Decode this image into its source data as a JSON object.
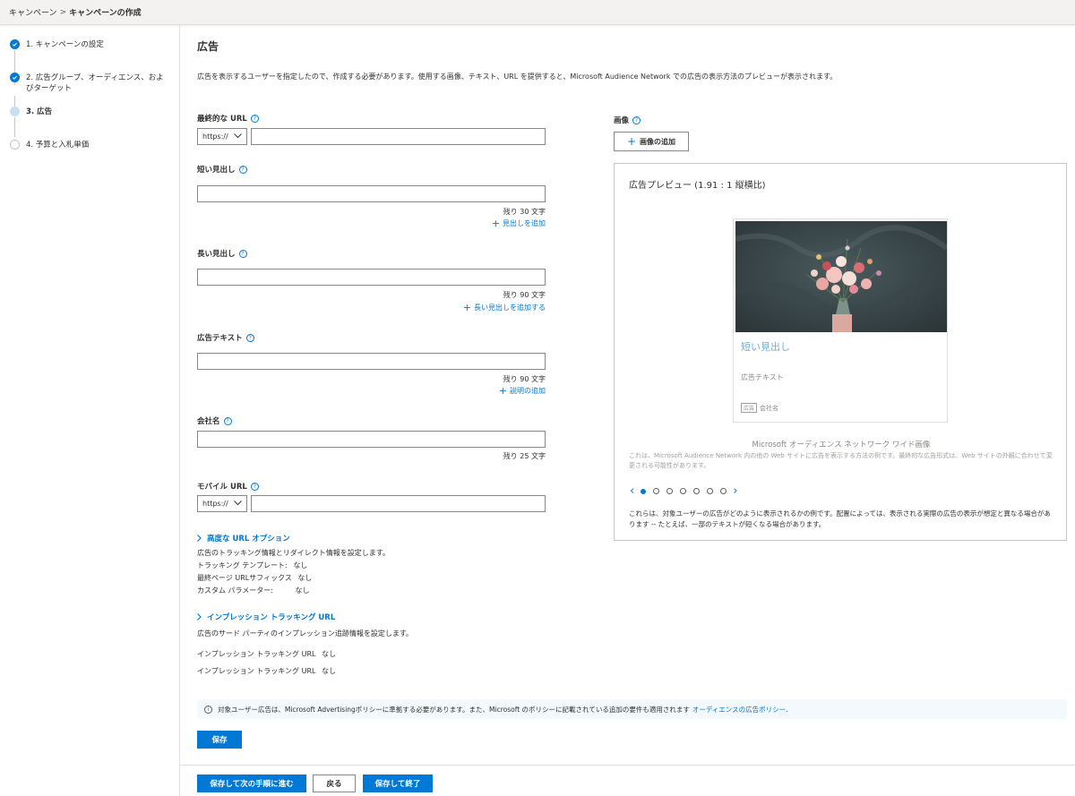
{
  "breadcrumb": {
    "parent": "キャンペーン",
    "separator": ">",
    "current": "キャンペーンの作成"
  },
  "steps": [
    {
      "label": "1. キャンペーンの設定",
      "state": "done"
    },
    {
      "label": "2. 広告グループ、オーディエンス、およびターゲット",
      "state": "done"
    },
    {
      "label": "3. 広告",
      "state": "current"
    },
    {
      "label": "4. 予算と入札単価",
      "state": "todo"
    }
  ],
  "page": {
    "title": "広告",
    "description": "広告を表示するユーザーを指定したので、作成する必要があります。使用する画像、テキスト、URL を提供すると、Microsoft Audience Network での広告の表示方法のプレビューが表示されます。"
  },
  "form": {
    "final_url": {
      "label": "最終的な URL",
      "protocol": "https://",
      "value": ""
    },
    "short_headline": {
      "label": "短い見出し",
      "value": "",
      "remaining": "残り 30 文字",
      "add_link": "見出しを追加"
    },
    "long_headline": {
      "label": "長い見出し",
      "value": "",
      "remaining": "残り 90 文字",
      "add_link": "長い見出しを追加する"
    },
    "ad_text": {
      "label": "広告テキスト",
      "value": "",
      "remaining": "残り 90 文字",
      "add_link": "説明の追加"
    },
    "company": {
      "label": "会社名",
      "value": "",
      "remaining": "残り 25 文字"
    },
    "mobile_url": {
      "label": "モバイル URL",
      "protocol": "https://",
      "value": ""
    }
  },
  "advanced_url": {
    "title": "高度な URL オプション",
    "description": "広告のトラッキング情報とリダイレクト情報を設定します。",
    "rows": [
      {
        "key": "トラッキング テンプレート:",
        "value": "なし"
      },
      {
        "key": "最終ページ URLサフィックス",
        "value": "なし"
      },
      {
        "key": "カスタム パラメーター:",
        "value": "なし"
      }
    ]
  },
  "impression_tracking": {
    "title": "インプレッション トラッキング URL",
    "description": "広告のサード パーティのインプレッション追跡情報を設定します。",
    "rows": [
      {
        "key": "インプレッション トラッキング URL",
        "value": "なし"
      },
      {
        "key": "インプレッション トラッキング URL",
        "value": "なし"
      }
    ]
  },
  "images": {
    "label": "画像",
    "add_button": "画像の追加"
  },
  "preview": {
    "title": "広告プレビュー (1.91 : 1 縦横比)",
    "card_headline": "短い見出し",
    "card_text": "広告テキスト",
    "card_badge": "広告",
    "card_company": "会社名",
    "caption": "Microsoft オーディエンス ネットワーク ワイド画像",
    "note": "これは、Microsoft Audience Network 内の他の Web サイトに広告を表示する方法の例です。最終的な広告形式は、Web サイトの外観に合わせて変更される可能性があります。",
    "pager_count": 7,
    "pager_active": 0,
    "disclaimer": "これらは、対象ユーザーの広告がどのように表示されるかの例です。配置によっては、表示される実際の広告の表示が想定と異なる場合があります -- たとえば、一部のテキストが短くなる場合があります。"
  },
  "info_bar": {
    "icon": "info-icon",
    "text": "対象ユーザー広告は、Microsoft Advertisingポリシーに準拠する必要があります。また、Microsoft のポリシーに記載されている追加の要件も適用されます",
    "link": "オーディエンスの広告ポリシー",
    "suffix": "."
  },
  "buttons": {
    "save": "保存",
    "save_next": "保存して次の手順に進む",
    "back": "戻る",
    "save_finish": "保存して終了"
  },
  "colors": {
    "accent": "#0078d4",
    "step_current": "#c7e0f4",
    "info_bg": "#f3f9fd"
  }
}
